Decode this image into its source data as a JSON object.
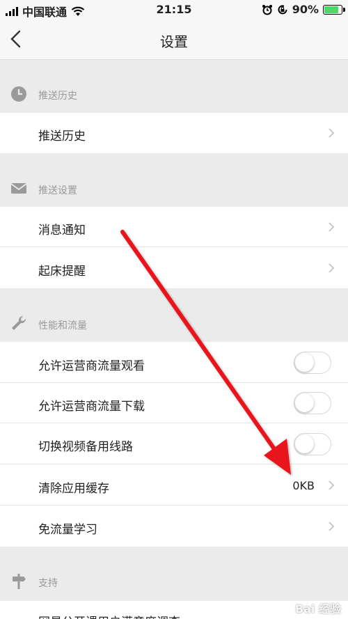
{
  "status_bar": {
    "carrier": "中国联通",
    "time": "21:15",
    "battery_percent": "90%",
    "battery_level": 0.9,
    "battery_color": "#4cd964"
  },
  "nav": {
    "title": "设置",
    "back_icon": "chevron-left-icon"
  },
  "sections": [
    {
      "header": "推送历史",
      "icon": "clock-icon",
      "rows": [
        {
          "label": "推送历史",
          "type": "disclosure"
        }
      ]
    },
    {
      "header": "推送设置",
      "icon": "envelope-icon",
      "rows": [
        {
          "label": "消息通知",
          "type": "disclosure"
        },
        {
          "label": "起床提醒",
          "type": "disclosure"
        }
      ]
    },
    {
      "header": "性能和流量",
      "icon": "wrench-icon",
      "rows": [
        {
          "label": "允许运营商流量观看",
          "type": "toggle",
          "on": false
        },
        {
          "label": "允许运营商流量下载",
          "type": "toggle",
          "on": false
        },
        {
          "label": "切换视频备用线路",
          "type": "toggle",
          "on": false
        },
        {
          "label": "清除应用缓存",
          "type": "value",
          "value": "0KB"
        },
        {
          "label": "免流量学习",
          "type": "disclosure"
        }
      ]
    },
    {
      "header": "支持",
      "icon": "signpost-icon",
      "rows": [
        {
          "label": "网易公开课用户满意度调查",
          "type": "disclosure"
        }
      ]
    }
  ],
  "annotation": {
    "arrow_color": "#e8141b",
    "watermark": "Bai 经验"
  }
}
